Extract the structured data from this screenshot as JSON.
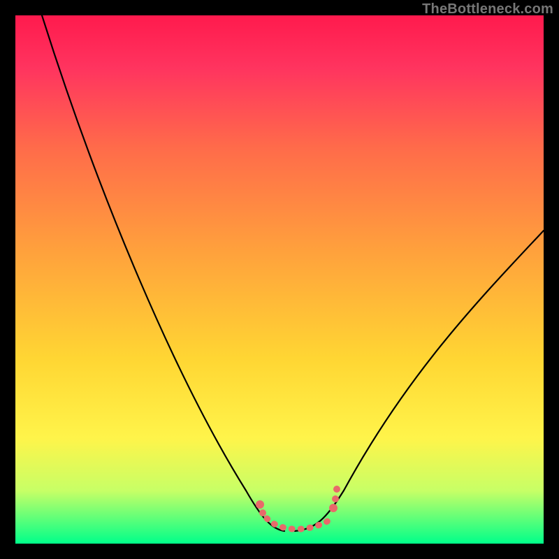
{
  "watermark": "TheBottleneck.com",
  "colors": {
    "page_bg": "#000000",
    "gradient_top": "#ff1a4d",
    "gradient_bottom": "#00ff8a",
    "curve": "#000000",
    "dots": "#e86a6a",
    "watermark_text": "#777777"
  },
  "chart_data": {
    "type": "line",
    "title": "",
    "xlabel": "",
    "ylabel": "",
    "xlim": [
      0,
      100
    ],
    "ylim": [
      0,
      100
    ],
    "grid": false,
    "legend": false,
    "series": [
      {
        "name": "bottleneck-curve",
        "x": [
          5,
          10,
          15,
          20,
          25,
          30,
          35,
          40,
          45,
          48,
          50,
          52,
          55,
          58,
          60,
          65,
          70,
          75,
          80,
          85,
          90,
          95,
          100
        ],
        "y": [
          100,
          91,
          82,
          73,
          63,
          52,
          41,
          30,
          17,
          8,
          3,
          1,
          1,
          3,
          8,
          17,
          26,
          34,
          41,
          47,
          52,
          56,
          59
        ]
      },
      {
        "name": "optimal-range-dots",
        "x": [
          46,
          48,
          50,
          52,
          54,
          56,
          57,
          58,
          59,
          60,
          60
        ],
        "y": [
          6,
          3,
          2,
          1.5,
          1.5,
          1.5,
          2,
          3,
          5,
          7,
          9
        ]
      }
    ],
    "annotations": []
  }
}
